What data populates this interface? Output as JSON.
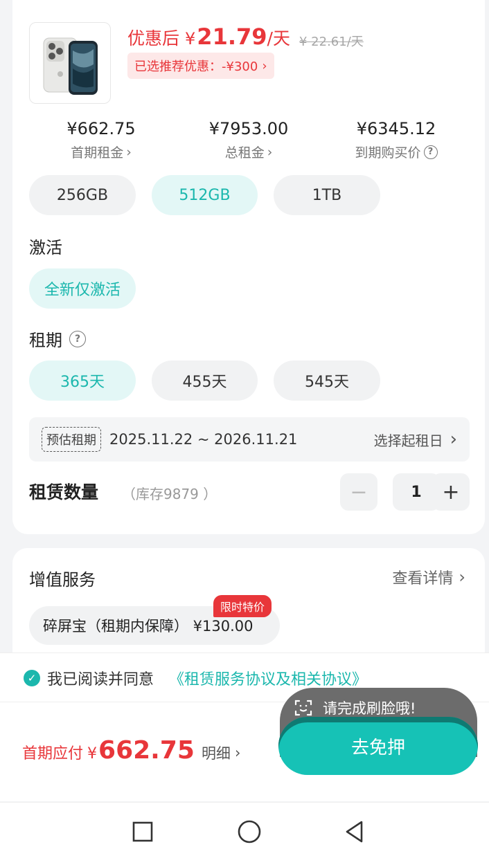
{
  "product": {
    "price_prefix": "优惠后",
    "currency": "¥",
    "daily_price": "21.79",
    "per_day": "/天",
    "original_price": "¥ 22.61/天",
    "promo_text": "已选推荐优惠：-¥300"
  },
  "stats": [
    {
      "value": "¥662.75",
      "label": "首期租金"
    },
    {
      "value": "¥7953.00",
      "label": "总租金"
    },
    {
      "value": "¥6345.12",
      "label": "到期购买价"
    }
  ],
  "storage": {
    "options": [
      "256GB",
      "512GB",
      "1TB"
    ],
    "selected": "512GB"
  },
  "activation": {
    "title": "激活",
    "options": [
      "全新仅激活"
    ],
    "selected": "全新仅激活"
  },
  "lease": {
    "title": "租期",
    "options": [
      "365天",
      "455天",
      "545天"
    ],
    "selected": "365天",
    "estimate_tag": "预估租期",
    "date_range": "2025.11.22 ~ 2026.11.21",
    "pick_start": "选择起租日"
  },
  "quantity": {
    "label": "租赁数量",
    "stock": "（库存9879 ）",
    "value": "1",
    "minus": "−",
    "plus": "+"
  },
  "services": {
    "title": "增值服务",
    "more": "查看详情",
    "item": "碎屏宝（租期内保障） ¥130.00",
    "badge": "限时特价"
  },
  "agreement": {
    "prefix": "我已阅读并同意",
    "link": "《租赁服务协议及相关协议》"
  },
  "payment": {
    "label": "首期应付",
    "currency": "¥",
    "amount": "662.75",
    "detail": "明细"
  },
  "tooltip": {
    "text": "请完成刷脸哦!"
  },
  "cta": {
    "label": "去免押"
  },
  "colors": {
    "accent": "#1bb7ad",
    "price_red": "#e8363a",
    "cta": "#16c2b6"
  }
}
